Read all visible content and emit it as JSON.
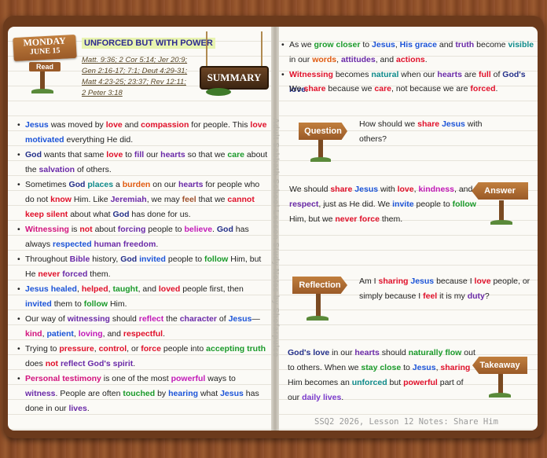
{
  "date_sign": {
    "day": "MONDAY",
    "month_day": "JUNE 15",
    "read_label": "Read"
  },
  "title": "UNFORCED BUT WITH POWER",
  "references": [
    "Matt. 9:36; 2 Cor 5:14; Jer 20:9;",
    "Gen 2:16-17; 7:1; Deut 4:29-31;",
    "Matt 4:23-25; 23:37; Rev 12:11;",
    "2 Peter 3:18"
  ],
  "summary_label": "SUMMARY",
  "signs": {
    "question": "Question",
    "answer": "Answer",
    "reflection": "Reflection",
    "takeaway": "Takeaway"
  },
  "watermark": "Adult Sabbath School Lesson Study Notes by Shofarpulse",
  "footer": "SSQ2 2026, Lesson 12 Notes: Share Him",
  "left_notes": [
    [
      [
        "Jesus",
        "b blue"
      ],
      [
        " was moved by "
      ],
      [
        "love",
        "b red"
      ],
      [
        " and "
      ],
      [
        "compassion",
        "b red"
      ],
      [
        " for people. This "
      ],
      [
        "love",
        "b red"
      ],
      [
        " "
      ],
      [
        "motivated",
        "b blue"
      ],
      [
        " everything He did."
      ]
    ],
    [
      [
        "God",
        "b navy"
      ],
      [
        " wants that same "
      ],
      [
        "love",
        "b red"
      ],
      [
        " to "
      ],
      [
        "fill",
        "b purple"
      ],
      [
        " our "
      ],
      [
        "hearts",
        "b purple"
      ],
      [
        " so that we "
      ],
      [
        "care",
        "b green"
      ],
      [
        " about the "
      ],
      [
        "salvation",
        "b purple"
      ],
      [
        " of others."
      ]
    ],
    [
      [
        "Sometimes "
      ],
      [
        "God",
        "b navy"
      ],
      [
        " "
      ],
      [
        "places",
        "b teal"
      ],
      [
        " a "
      ],
      [
        "burden",
        "b orange"
      ],
      [
        " on our "
      ],
      [
        "hearts",
        "b purple"
      ],
      [
        " for people who do not "
      ],
      [
        "know",
        "b red"
      ],
      [
        " Him. Like "
      ],
      [
        "Jeremiah",
        "b purple"
      ],
      [
        ", we may "
      ],
      [
        "feel",
        "b brown"
      ],
      [
        " that we "
      ],
      [
        "cannot keep silent",
        "b red"
      ],
      [
        " about what "
      ],
      [
        "God",
        "b navy"
      ],
      [
        " has done for us."
      ]
    ],
    [
      [
        "Witnessing",
        "b pink"
      ],
      [
        " is "
      ],
      [
        "not",
        "b red"
      ],
      [
        " about "
      ],
      [
        "forcing",
        "b purple"
      ],
      [
        " people to "
      ],
      [
        "believe",
        "b magenta"
      ],
      [
        ". "
      ],
      [
        "God",
        "b navy"
      ],
      [
        " has always "
      ],
      [
        "respected",
        "b blue"
      ],
      [
        " "
      ],
      [
        "human freedom",
        "b purple"
      ],
      [
        "."
      ]
    ],
    [
      [
        "Throughout "
      ],
      [
        "Bible",
        "b purple"
      ],
      [
        " history, "
      ],
      [
        "God",
        "b navy"
      ],
      [
        " "
      ],
      [
        "invited",
        "b blue"
      ],
      [
        " people to "
      ],
      [
        "follow",
        "b green"
      ],
      [
        " Him, but He "
      ],
      [
        "never",
        "b red"
      ],
      [
        " "
      ],
      [
        "forced",
        "b purple"
      ],
      [
        " them."
      ]
    ],
    [
      [
        "Jesus",
        "b blue"
      ],
      [
        " "
      ],
      [
        "healed",
        "b blue"
      ],
      [
        ", "
      ],
      [
        "helped",
        "b red"
      ],
      [
        ", "
      ],
      [
        "taught",
        "b green"
      ],
      [
        ", and "
      ],
      [
        "loved",
        "b red"
      ],
      [
        " people first, then "
      ],
      [
        "invited",
        "b blue"
      ],
      [
        " them to "
      ],
      [
        "follow",
        "b green"
      ],
      [
        " Him."
      ]
    ],
    [
      [
        "Our way of "
      ],
      [
        "witnessing",
        "b purple"
      ],
      [
        " should "
      ],
      [
        "reflect",
        "b magenta"
      ],
      [
        " the "
      ],
      [
        "character",
        "b purple"
      ],
      [
        " of "
      ],
      [
        "Jesus",
        "b blue"
      ],
      [
        "— "
      ],
      [
        "kind",
        "b pink"
      ],
      [
        ", "
      ],
      [
        "patient",
        "b blue"
      ],
      [
        ", "
      ],
      [
        "loving",
        "b magenta"
      ],
      [
        ", and "
      ],
      [
        "respectful",
        "b red"
      ],
      [
        "."
      ]
    ],
    [
      [
        "Trying to "
      ],
      [
        "pressure",
        "b red"
      ],
      [
        ", "
      ],
      [
        "control",
        "b red"
      ],
      [
        ", or "
      ],
      [
        "force",
        "b red"
      ],
      [
        " people into "
      ],
      [
        "accepting truth",
        "b green"
      ],
      [
        " does "
      ],
      [
        "not",
        "b red"
      ],
      [
        " "
      ],
      [
        "reflect",
        "b purple"
      ],
      [
        " "
      ],
      [
        "God's spirit",
        "b purple"
      ],
      [
        "."
      ]
    ],
    [
      [
        "Personal testimony",
        "b pink"
      ],
      [
        " is one of the most "
      ],
      [
        "powerful",
        "b magenta"
      ],
      [
        " ways to "
      ],
      [
        "witness",
        "b purple"
      ],
      [
        ". People are often "
      ],
      [
        "touched",
        "b green"
      ],
      [
        " by "
      ],
      [
        "hearing",
        "b blue"
      ],
      [
        " what "
      ],
      [
        "Jesus",
        "b blue"
      ],
      [
        " has done in our "
      ],
      [
        "lives",
        "b purple"
      ],
      [
        "."
      ]
    ]
  ],
  "right_notes": [
    [
      [
        "As we "
      ],
      [
        "grow closer",
        "b green"
      ],
      [
        " to "
      ],
      [
        "Jesus",
        "b blue"
      ],
      [
        ", "
      ],
      [
        "His grace",
        "b blue"
      ],
      [
        " and "
      ],
      [
        "truth",
        "b purple"
      ],
      [
        " become "
      ],
      [
        "visible",
        "b teal"
      ],
      [
        " in our "
      ],
      [
        "words",
        "b orange"
      ],
      [
        ", "
      ],
      [
        "attitudes",
        "b purple"
      ],
      [
        ", and "
      ],
      [
        "actions",
        "b red"
      ],
      [
        "."
      ]
    ],
    [
      [
        "Witnessing",
        "b red"
      ],
      [
        " becomes "
      ],
      [
        "natural",
        "b teal"
      ],
      [
        " when our "
      ],
      [
        "hearts",
        "b purple"
      ],
      [
        " are "
      ],
      [
        "full",
        "b red"
      ],
      [
        " of "
      ],
      [
        "God's love",
        "b navy"
      ],
      [
        "."
      ]
    ]
  ],
  "right_extra": [
    [
      "We "
    ],
    [
      "share",
      "b red"
    ],
    [
      " because we "
    ],
    [
      "care",
      "b red"
    ],
    [
      ", not because we are "
    ],
    [
      "forced",
      "b red"
    ],
    [
      "."
    ]
  ],
  "question": [
    [
      "How should we "
    ],
    [
      "share",
      "b red"
    ],
    [
      " "
    ],
    [
      "Jesus",
      "b blue"
    ],
    [
      " with others?"
    ]
  ],
  "answer": [
    [
      "We should "
    ],
    [
      "share",
      "b red"
    ],
    [
      " "
    ],
    [
      "Jesus",
      "b blue"
    ],
    [
      " with "
    ],
    [
      "love",
      "b red"
    ],
    [
      ", "
    ],
    [
      "kindness",
      "b magenta"
    ],
    [
      ", and "
    ],
    [
      "respect",
      "b purple"
    ],
    [
      ", just as He did. We "
    ],
    [
      "invite",
      "b blue"
    ],
    [
      " people to "
    ],
    [
      "follow",
      "b green"
    ],
    [
      " Him, but we "
    ],
    [
      "never force",
      "b red"
    ],
    [
      " them."
    ]
  ],
  "reflection": [
    [
      "Am I "
    ],
    [
      "sharing",
      "b red"
    ],
    [
      " "
    ],
    [
      "Jesus",
      "b blue"
    ],
    [
      " because I "
    ],
    [
      "love",
      "b red"
    ],
    [
      " people, or simply because I "
    ],
    [
      "feel",
      "b red"
    ],
    [
      " it is my "
    ],
    [
      "duty",
      "b purple"
    ],
    [
      "?"
    ]
  ],
  "takeaway": [
    [
      "God's love",
      "b navy"
    ],
    [
      " in our "
    ],
    [
      "hearts",
      "b purple"
    ],
    [
      " should "
    ],
    [
      "naturally flow",
      "b green"
    ],
    [
      " out to others. When we "
    ],
    [
      "stay close",
      "b green"
    ],
    [
      " to "
    ],
    [
      "Jesus",
      "b blue"
    ],
    [
      ", "
    ],
    [
      "sharing",
      "b red"
    ],
    [
      " Him becomes an "
    ],
    [
      "unforced",
      "b teal"
    ],
    [
      " but "
    ],
    [
      "powerful",
      "b red"
    ],
    [
      " part of our "
    ],
    [
      "daily lives",
      "b violet"
    ],
    [
      "."
    ]
  ],
  "colors": {
    "wood": "#9a5a30",
    "page": "#fbfaf6",
    "title_bg": "#e8f4b0",
    "sign": "#b06f34"
  }
}
